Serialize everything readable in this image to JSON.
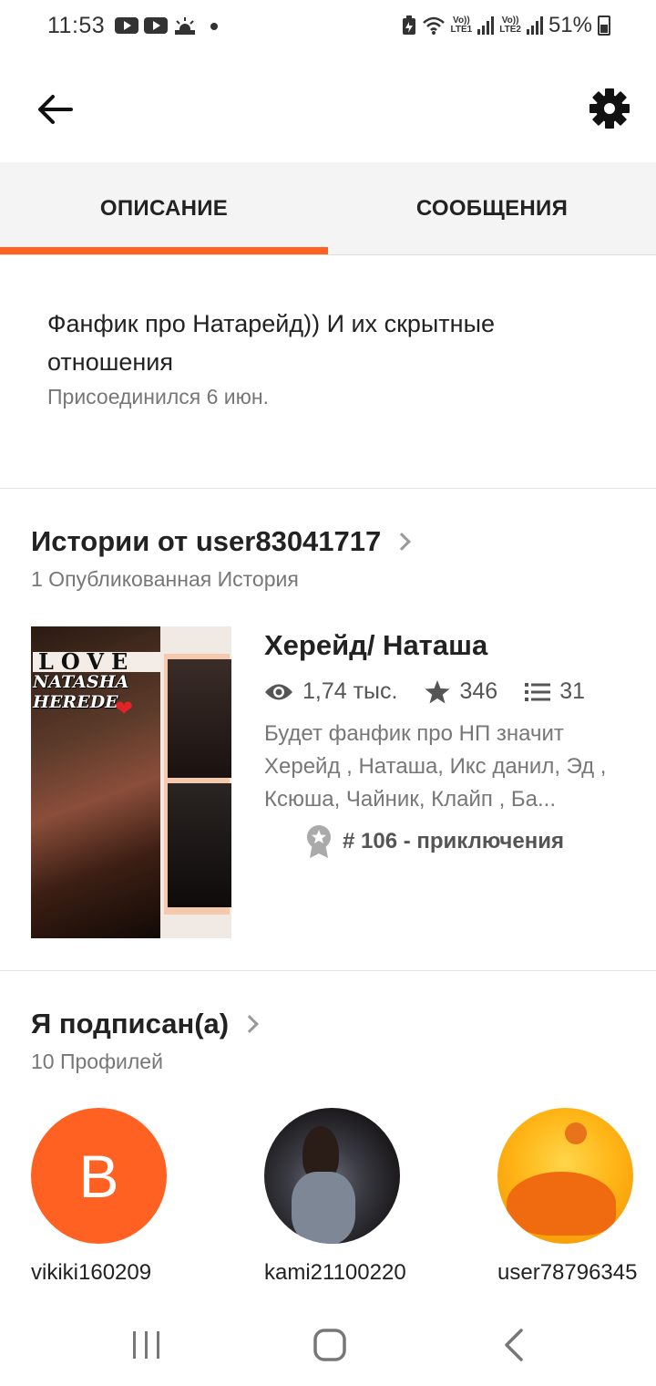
{
  "status": {
    "time": "11:53",
    "battery": "51%",
    "sim1": "Vo))\nLTE1",
    "sim2": "Vo))\nLTE2",
    "icons": [
      "youtube-icon",
      "youtube-icon",
      "weather-icon",
      "notification-dot",
      "battery-saver-icon",
      "wifi-icon",
      "signal-icon",
      "battery-icon"
    ]
  },
  "header": {
    "back_icon": "arrow-left-icon",
    "settings_icon": "gear-icon"
  },
  "tabs": [
    {
      "label": "ОПИСАНИЕ",
      "active": true
    },
    {
      "label": "СООБЩЕНИЯ",
      "active": false
    }
  ],
  "accent_color": "#ff6122",
  "description": {
    "text": "Фанфик про Натарейд)) И их скрытные отношения",
    "joined": "Присоединился 6 июн."
  },
  "stories": {
    "title": "Истории от user83041717",
    "subtitle": "1 Опубликованная История",
    "items": [
      {
        "cover_text": {
          "love": "LOVE",
          "name1": "NATASHA",
          "name2": "HEREDE"
        },
        "title": "Херейд/ Наташа",
        "views": "1,74 тыс.",
        "votes": "346",
        "parts": "31",
        "description": "Будет фанфик про НП значит Херейд , Наташа, Икс данил, Эд , Ксюша, Чайник, Клайп , Ба...",
        "rank": "# 106 - приключения"
      }
    ]
  },
  "following": {
    "title": "Я подписан(а)",
    "subtitle": "10 Профилей",
    "profiles": [
      {
        "name": "vikiki160209",
        "initial": "B",
        "avatar_color": "#ff6122"
      },
      {
        "name": "kami21100220"
      },
      {
        "name": "user78796345"
      }
    ]
  },
  "nav": {
    "icons": [
      "recent-apps-icon",
      "home-icon",
      "back-icon"
    ]
  }
}
